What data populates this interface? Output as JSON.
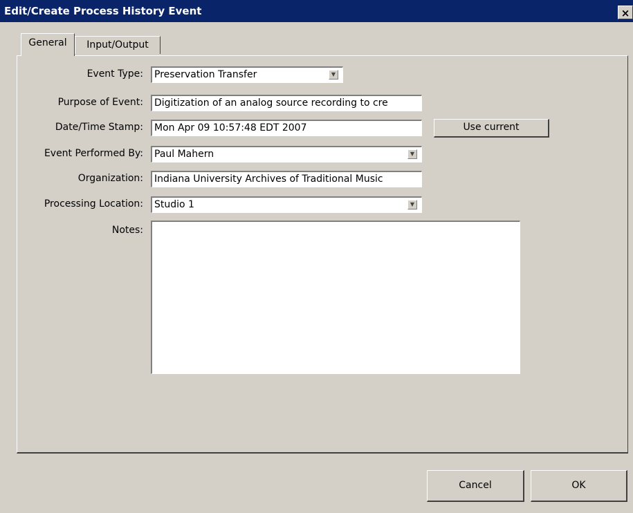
{
  "window": {
    "title": "Edit/Create Process History Event",
    "close_glyph": "×"
  },
  "tabs": [
    {
      "label": "General",
      "active": true
    },
    {
      "label": "Input/Output",
      "active": false
    }
  ],
  "form": {
    "event_type": {
      "label": "Event Type:",
      "value": "Preservation Transfer"
    },
    "purpose": {
      "label": "Purpose of Event:",
      "value": "Digitization of an analog source recording to cre"
    },
    "datetime": {
      "label": "Date/Time Stamp:",
      "value": "Mon Apr 09 10:57:48 EDT 2007",
      "button": "Use current"
    },
    "performed_by": {
      "label": "Event Performed By:",
      "value": "Paul Mahern"
    },
    "organization": {
      "label": "Organization:",
      "value": "Indiana University Archives of Traditional Music"
    },
    "location": {
      "label": "Processing Location:",
      "value": "Studio 1"
    },
    "notes": {
      "label": "Notes:",
      "value": ""
    }
  },
  "buttons": {
    "cancel": "Cancel",
    "ok": "OK"
  },
  "icons": {
    "dropdown": "chevron-down-icon"
  }
}
